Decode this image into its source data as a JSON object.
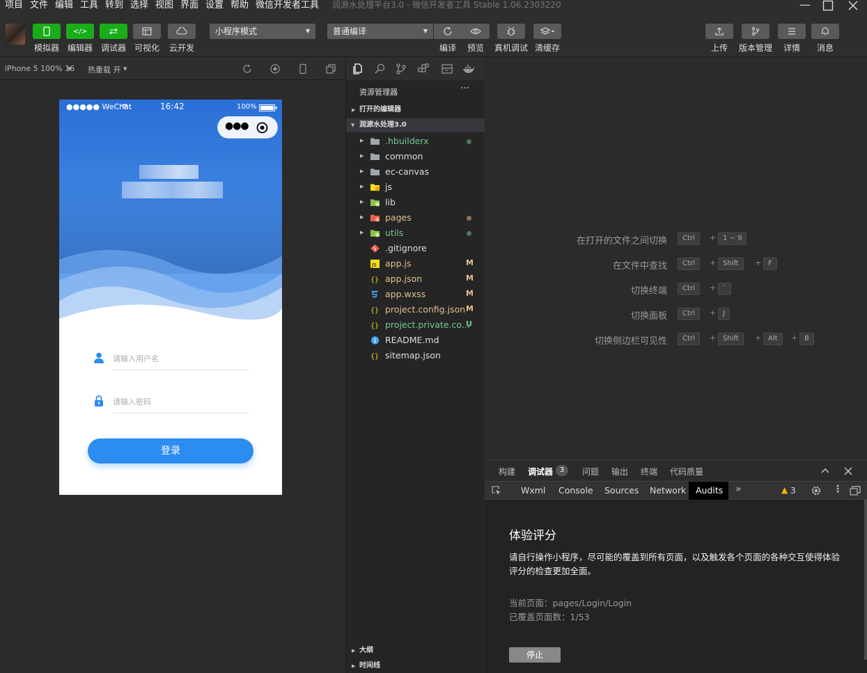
{
  "menubar": {
    "items": [
      "项目",
      "文件",
      "编辑",
      "工具",
      "转到",
      "选择",
      "视图",
      "界面",
      "设置",
      "帮助",
      "微信开发者工具"
    ],
    "window_title": "润源水处理平台3.0 - 微信开发者工具 Stable 1.06.2303220"
  },
  "toolbar": {
    "left_buttons": [
      "模拟器",
      "编辑器",
      "调试器",
      "可视化",
      "云开发"
    ],
    "mode_select": "小程序模式",
    "compile_select": "普通编译",
    "mid_buttons": [
      "编译",
      "预览",
      "真机调试",
      "清缓存"
    ],
    "right_buttons": [
      "上传",
      "版本管理",
      "详情",
      "消息"
    ]
  },
  "simulator": {
    "device": "iPhone 5 100% 16",
    "hot_reload": "热重载 开",
    "status": {
      "carrier": "●●●●● WeChat",
      "time": "16:42",
      "battery": "100%"
    },
    "username_placeholder": "请输入用户名",
    "password_placeholder": "请输入密码",
    "login_label": "登录"
  },
  "explorer": {
    "title": "资源管理器",
    "more": "···",
    "open_editors": "打开的编辑器",
    "project": "润源水处理3.0",
    "files": [
      {
        "name": ".hbuilderx",
        "type": "folder",
        "color": "#73c991",
        "dot": "#4e7a57"
      },
      {
        "name": "common",
        "type": "folder",
        "color": "#dddddd"
      },
      {
        "name": "ec-canvas",
        "type": "folder",
        "color": "#dddddd"
      },
      {
        "name": "js",
        "type": "folder-js",
        "color": "#dddddd"
      },
      {
        "name": "lib",
        "type": "folder-lib",
        "color": "#dddddd"
      },
      {
        "name": "pages",
        "type": "folder-pages",
        "color": "#e2c08d",
        "dot": "#8a7550"
      },
      {
        "name": "utils",
        "type": "folder-utils",
        "color": "#73c991",
        "dot": "#4e7a57"
      },
      {
        "name": ".gitignore",
        "type": "git",
        "color": "#dddddd"
      },
      {
        "name": "app.js",
        "type": "js",
        "color": "#e2c08d",
        "badge": "M"
      },
      {
        "name": "app.json",
        "type": "json",
        "color": "#e2c08d",
        "badge": "M"
      },
      {
        "name": "app.wxss",
        "type": "css",
        "color": "#e2c08d",
        "badge": "M"
      },
      {
        "name": "project.config.json",
        "type": "json",
        "color": "#e2c08d",
        "badge": "M"
      },
      {
        "name": "project.private.co...",
        "type": "json",
        "color": "#73c991",
        "badge": "U"
      },
      {
        "name": "README.md",
        "type": "info",
        "color": "#dddddd"
      },
      {
        "name": "sitemap.json",
        "type": "json",
        "color": "#dddddd"
      }
    ],
    "outline": "大纲",
    "timeline": "时间线"
  },
  "editor": {
    "shortcuts": [
      {
        "label": "在打开的文件之间切换",
        "keys": [
          "Ctrl",
          "1 ~ 9"
        ]
      },
      {
        "label": "在文件中查找",
        "keys": [
          "Ctrl",
          "Shift",
          "F"
        ]
      },
      {
        "label": "切换终端",
        "keys": [
          "Ctrl",
          "`"
        ]
      },
      {
        "label": "切换面板",
        "keys": [
          "Ctrl",
          "J"
        ]
      },
      {
        "label": "切换侧边栏可见性",
        "keys": [
          "Ctrl",
          "Shift",
          "Alt",
          "B"
        ]
      }
    ]
  },
  "debugger": {
    "tabs": [
      "构建",
      "调试器",
      "问题",
      "输出",
      "终端",
      "代码质量"
    ],
    "badge": "3",
    "devtools_tabs": [
      "Wxml",
      "Console",
      "Sources",
      "Network",
      "Audits"
    ],
    "warning_count": "3",
    "audits": {
      "title": "体验评分",
      "desc": "请自行操作小程序，尽可能的覆盖到所有页面，以及触发各个页面的各种交互使得体验评分的检查更加全面。",
      "current_page": "当前页面：pages/Login/Login",
      "covered": "已覆盖页面数：1/53",
      "stop": "停止"
    }
  }
}
